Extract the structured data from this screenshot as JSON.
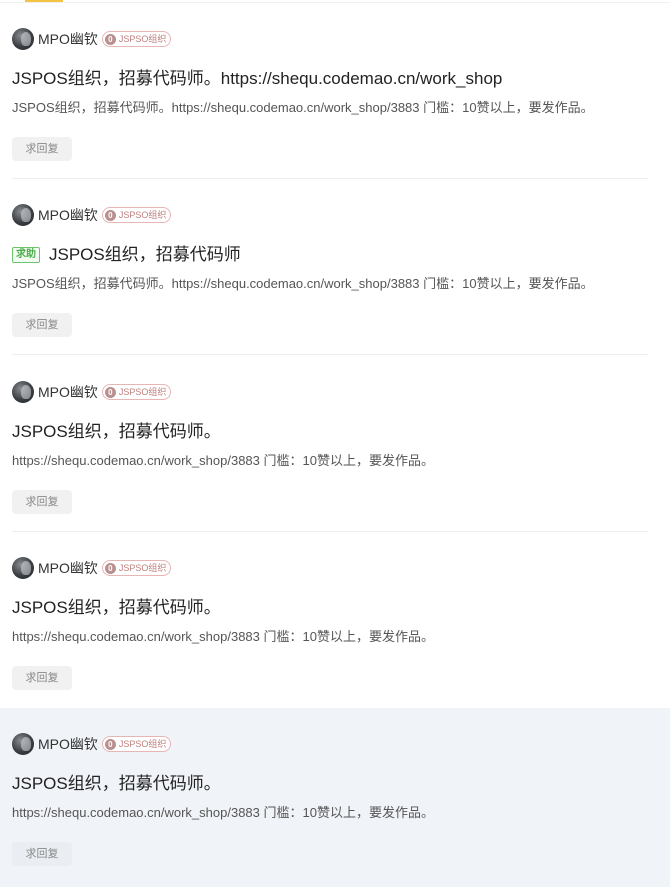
{
  "posts": [
    {
      "author": "MPO幽钦",
      "badge_level": "0",
      "badge_org": "JSPSO组织",
      "help_tag": "",
      "title": "JSPOS组织，招募代码师。https://shequ.codemao.cn/work_shop",
      "body": "JSPOS组织，招募代码师。https://shequ.codemao.cn/work_shop/3883 门槛：10赞以上，要发作品。",
      "reply_label": "求回复"
    },
    {
      "author": "MPO幽钦",
      "badge_level": "0",
      "badge_org": "JSPSO组织",
      "help_tag": "求助",
      "title": "JSPOS组织，招募代码师",
      "body": "JSPOS组织，招募代码师。https://shequ.codemao.cn/work_shop/3883 门槛：10赞以上，要发作品。",
      "reply_label": "求回复"
    },
    {
      "author": "MPO幽钦",
      "badge_level": "0",
      "badge_org": "JSPSO组织",
      "help_tag": "",
      "title": "JSPOS组织，招募代码师。",
      "body": "https://shequ.codemao.cn/work_shop/3883 门槛：10赞以上，要发作品。",
      "reply_label": "求回复"
    },
    {
      "author": "MPO幽钦",
      "badge_level": "0",
      "badge_org": "JSPSO组织",
      "help_tag": "",
      "title": "JSPOS组织，招募代码师。",
      "body": "https://shequ.codemao.cn/work_shop/3883 门槛：10赞以上，要发作品。",
      "reply_label": "求回复"
    },
    {
      "author": "MPO幽钦",
      "badge_level": "0",
      "badge_org": "JSPSO组织",
      "help_tag": "",
      "title": "JSPOS组织，招募代码师。",
      "body": "https://shequ.codemao.cn/work_shop/3883 门槛：10赞以上，要发作品。",
      "reply_label": "求回复"
    }
  ],
  "colors": {
    "accent": "#f4c244",
    "help_tag_green": "#4cae4c",
    "badge_pink": "#c07f7f",
    "highlight_bg": "#f0f3f7"
  }
}
